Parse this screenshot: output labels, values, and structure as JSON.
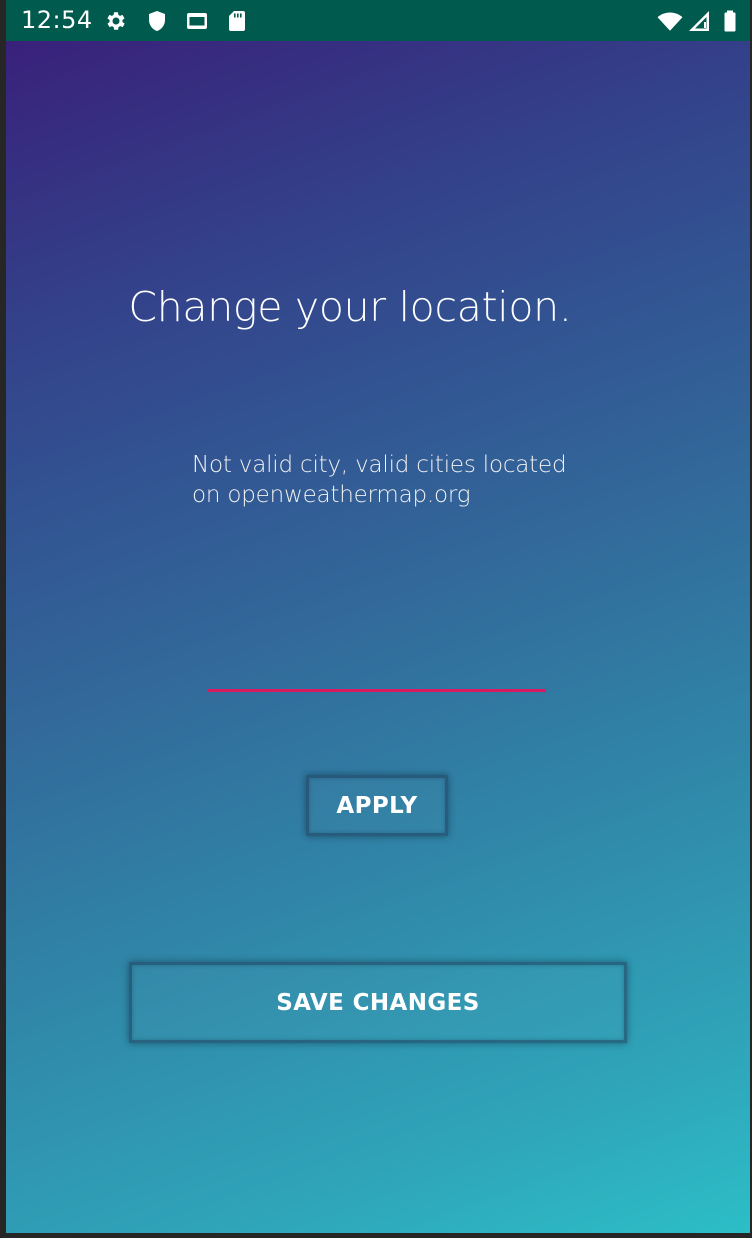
{
  "status_bar": {
    "time": "12:54",
    "left_icons": [
      "gear-icon",
      "shield-icon",
      "screen-icon",
      "sd-card-icon"
    ],
    "right_icons": [
      "wifi-icon",
      "signal-icon",
      "battery-icon"
    ],
    "background_color": "#015a4e"
  },
  "main": {
    "title": "Change your location.",
    "message": "Not valid city, valid cities located on openweathermap.org",
    "city_input": {
      "value": "",
      "placeholder": ""
    },
    "apply_label": "APPLY",
    "save_label": "SAVE CHANGES"
  },
  "colors": {
    "gradient_start": "#3a1c78",
    "gradient_end": "#2cbec7",
    "input_underline": "#d81b60",
    "text": "#ffffff"
  }
}
